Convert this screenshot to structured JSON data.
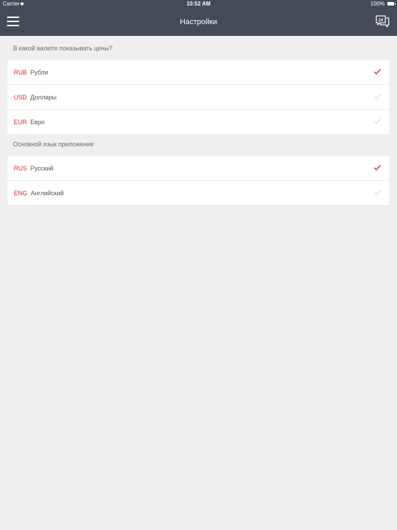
{
  "status_bar": {
    "carrier": "Carrier",
    "time": "10:52 AM",
    "battery": "100%"
  },
  "nav": {
    "title": "Настройки",
    "menu_icon": "hamburger-menu-icon",
    "chat_icon": "chat-24-icon",
    "chat_badge": "24"
  },
  "currency": {
    "label": "В какой валюте показывать цены?",
    "items": [
      {
        "code": "RUB",
        "name": "Рубли",
        "selected": true
      },
      {
        "code": "USD",
        "name": "Доллары",
        "selected": false
      },
      {
        "code": "EUR",
        "name": "Евро",
        "selected": false
      }
    ]
  },
  "language": {
    "label": "Основной язык приложения",
    "items": [
      {
        "code": "RUS",
        "name": "Русский",
        "selected": true
      },
      {
        "code": "ENG",
        "name": "Английский",
        "selected": false
      }
    ]
  },
  "colors": {
    "accent": "#e8242b",
    "check_inactive": "#d8d8d8",
    "header_bg": "#454a57"
  }
}
